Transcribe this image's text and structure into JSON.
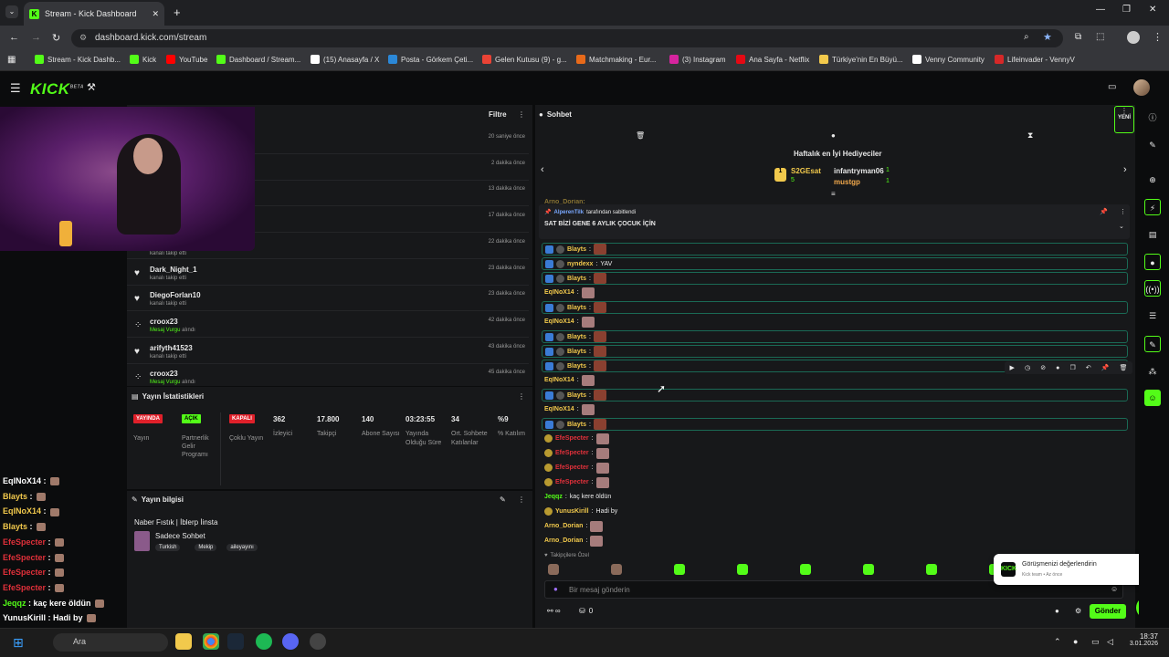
{
  "browser": {
    "tab_title": "Stream - Kick Dashboard",
    "url": "dashboard.kick.com/stream",
    "bookmarks": [
      {
        "label": "Stream - Kick Dashb...",
        "color": "#53fc18"
      },
      {
        "label": "Kick",
        "color": "#53fc18"
      },
      {
        "label": "YouTube",
        "color": "#ff0000"
      },
      {
        "label": "Dashboard / Stream...",
        "color": "#53fc18"
      },
      {
        "label": "(15) Anasayfa / X",
        "color": "#ffffff"
      },
      {
        "label": "Posta - Görkem Çeti...",
        "color": "#2b88d8"
      },
      {
        "label": "Gelen Kutusu (9) - g...",
        "color": "#ea4335"
      },
      {
        "label": "Matchmaking - Eur...",
        "color": "#e86a1a"
      },
      {
        "label": "(3) Instagram",
        "color": "#d6249f"
      },
      {
        "label": "Ana Sayfa - Netflix",
        "color": "#e50914"
      },
      {
        "label": "Türkiye'nin En Büyü...",
        "color": "#f2c94c"
      },
      {
        "label": "Venny Community",
        "color": "#ffffff"
      },
      {
        "label": "Lifeinvader - VennyV",
        "color": "#d62828"
      }
    ]
  },
  "kick": {
    "logo": "KICK",
    "beta": "BETA"
  },
  "activity": {
    "filter_label": "Filtre",
    "events": [
      {
        "name": "",
        "sub": "",
        "time": "20 saniye önce",
        "icon": "heart-icon"
      },
      {
        "name": "",
        "sub": "",
        "time": "2 dakika önce",
        "icon": "heart-icon"
      },
      {
        "name": "",
        "sub": "",
        "time": "13 dakika önce",
        "icon": "heart-icon"
      },
      {
        "name": "",
        "sub": "",
        "time": "17 dakika önce",
        "icon": "heart-icon"
      },
      {
        "name": "",
        "sub": "kanalı takip etti",
        "time": "22 dakika önce",
        "icon": "heart-icon"
      },
      {
        "name": "Dark_Night_1",
        "sub": "kanalı takip etti",
        "time": "23 dakika önce",
        "icon": "heart-icon"
      },
      {
        "name": "DiegoForlan10",
        "sub": "kanalı takip etti",
        "time": "23 dakika önce",
        "icon": "heart-icon"
      },
      {
        "name": "croox23",
        "sub_highlight": "Mesaj Vurgu",
        "sub": "alındı",
        "time": "42 dakika önce",
        "icon": "spark-icon"
      },
      {
        "name": "arifyth41523",
        "sub": "kanalı takip etti",
        "time": "43 dakika önce",
        "icon": "heart-icon"
      },
      {
        "name": "croox23",
        "sub_highlight": "Mesaj Vurgu",
        "sub": "alındı",
        "time": "45 dakika önce",
        "icon": "spark-icon"
      }
    ]
  },
  "stats": {
    "title": "Yayın İstatistikleri",
    "badges": [
      {
        "badge": "YAYINDA",
        "label": "Yayın",
        "color": "#e0202a"
      },
      {
        "badge": "AÇIK",
        "label": "Partnerlik Gelir Programı",
        "color": "#53fc18"
      },
      {
        "badge": "KAPALI",
        "label": "Çoklu Yayın",
        "color": "#e0202a"
      }
    ],
    "numbers": [
      {
        "value": "362",
        "label": "İzleyici"
      },
      {
        "value": "17.800",
        "label": "Takipçi"
      },
      {
        "value": "140",
        "label": "Abone Sayısı"
      },
      {
        "value": "03:23:55",
        "label": "Yayında Olduğu Süre"
      },
      {
        "value": "34",
        "label": "Ort. Sohbete Katılanlar"
      },
      {
        "value": "%9",
        "label": "% Katılım"
      }
    ]
  },
  "stream_info": {
    "title": "Yayın bilgisi",
    "stream_title": "Naber Fıstık | İblerp İinsta",
    "category": "Sadece Sohbet",
    "tags": [
      "Turkish",
      "Mekip",
      "aileyayını"
    ]
  },
  "overlay_chat": [
    {
      "user": "EqINoX14",
      "sep": " :",
      "color": "#ffffff"
    },
    {
      "user": "Blayts",
      "sep": " :",
      "color": "#f2c94c"
    },
    {
      "user": "EqINoX14",
      "sep": " :",
      "color": "#f2c94c"
    },
    {
      "user": "Blayts",
      "sep": " :",
      "color": "#f2c94c"
    },
    {
      "user": "EfeSpecter",
      "sep": " :",
      "color": "#e0303a"
    },
    {
      "user": "EfeSpecter",
      "sep": " :",
      "color": "#e0303a"
    },
    {
      "user": "EfeSpecter",
      "sep": " :",
      "color": "#e0303a"
    },
    {
      "user": "EfeSpecter",
      "sep": " :",
      "color": "#e0303a"
    },
    {
      "user": "Jeqqz",
      "sep": " : kaç kere öldün",
      "color": "#53fc18"
    },
    {
      "user": "YunusKirill",
      "sep": " : Hadi by",
      "color": "#ffffff"
    },
    {
      "user": "Arno_Dorian",
      "sep": " :",
      "color": "#f2c94c"
    },
    {
      "user": "Arno_Dorian",
      "sep": " :",
      "color": "#f2c94c"
    }
  ],
  "chat": {
    "title": "Sohbet",
    "new_label": "YENİ",
    "top_gifters_title": "Haftalık en İyi Hediyeciler",
    "gifters": [
      {
        "name": "S2GEsat",
        "count": "5"
      },
      {
        "name": "infantryman06",
        "count": "1"
      },
      {
        "name": "mustgp",
        "count": "1"
      }
    ],
    "pinned_by": "AlperenTilk",
    "pinned_suffix": "tarafından sabitlendi",
    "pinned_message": "SAT BİZİ GENE 6 AYLIK ÇOCUK İÇİN",
    "partial_user": "Arno_Dorian:",
    "messages": [
      {
        "user": "Blayts",
        "text": "",
        "color": "#f2c94c",
        "hl": true
      },
      {
        "user": "nyndexx",
        "text": " YAV",
        "color": "#f2c94c",
        "hl": true
      },
      {
        "user": "Blayts",
        "text": "",
        "color": "#f2c94c",
        "hl": true
      },
      {
        "user": "EqINoX14",
        "text": "",
        "color": "#f2c94c",
        "hl": false
      },
      {
        "user": "Blayts",
        "text": "",
        "color": "#f2c94c",
        "hl": true
      },
      {
        "user": "EqINoX14",
        "text": "",
        "color": "#f2c94c",
        "hl": false
      },
      {
        "user": "Blayts",
        "text": "",
        "color": "#f2c94c",
        "hl": true
      },
      {
        "user": "Blayts",
        "text": "",
        "color": "#f2c94c",
        "hl": true
      },
      {
        "user": "Blayts",
        "text": "",
        "color": "#f2c94c",
        "hl": true
      },
      {
        "user": "EqINoX14",
        "text": "",
        "color": "#f2c94c",
        "hl": false
      },
      {
        "user": "Blayts",
        "text": "",
        "color": "#f2c94c",
        "hl": true
      },
      {
        "user": "EqINoX14",
        "text": "",
        "color": "#f2c94c",
        "hl": false
      },
      {
        "user": "Blayts",
        "text": "",
        "color": "#f2c94c",
        "hl": true
      },
      {
        "user": "EfeSpecter",
        "text": "",
        "color": "#e0303a",
        "hl": false
      },
      {
        "user": "EfeSpecter",
        "text": "",
        "color": "#e0303a",
        "hl": false
      },
      {
        "user": "EfeSpecter",
        "text": "",
        "color": "#e0303a",
        "hl": false
      },
      {
        "user": "EfeSpecter",
        "text": "",
        "color": "#e0303a",
        "hl": false
      },
      {
        "user": "Jeqqz",
        "text": " kaç kere öldün",
        "color": "#53fc18",
        "hl": false
      },
      {
        "user": "YunusKirill",
        "text": " Hadi by",
        "color": "#f2c94c",
        "hl": false
      },
      {
        "user": "Arno_Dorian",
        "text": "",
        "color": "#f2c94c",
        "hl": false
      },
      {
        "user": "Arno_Dorian",
        "text": "",
        "color": "#f2c94c",
        "hl": false
      }
    ],
    "followers_only": "Takipçilere Özel",
    "input_placeholder": "Bir mesaj gönderin",
    "viewer_count": "0",
    "send_label": "Gönder"
  },
  "toast": {
    "title": "Görüşmenizi değerlendirin",
    "sub": "Kick team • Az önce"
  },
  "taskbar": {
    "search": "Ara",
    "time": "18:37",
    "date": "3.01.2026"
  }
}
